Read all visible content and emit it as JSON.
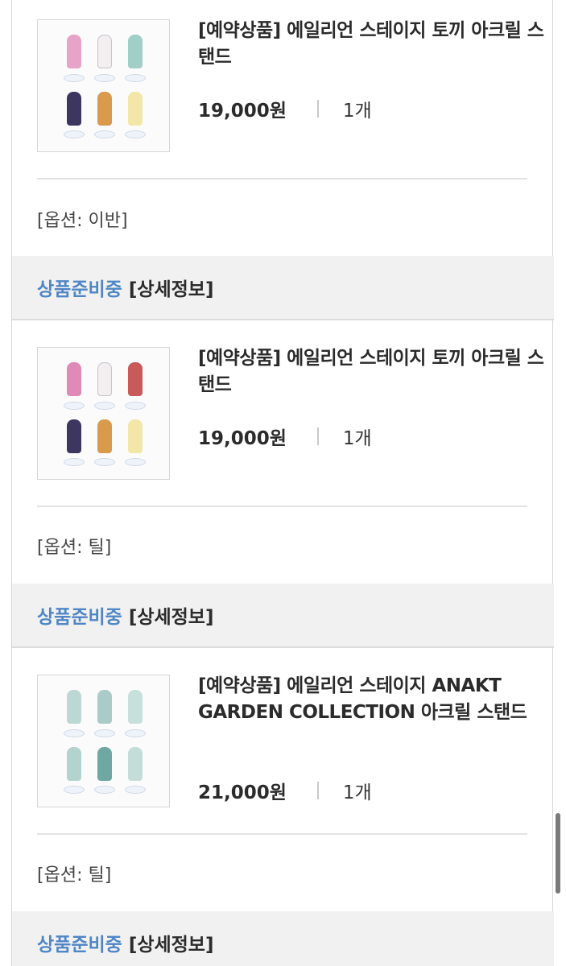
{
  "items": [
    {
      "title": "[예약상품] 에일리언 스테이지 토끼 아크릴 스탠드",
      "price": "19,000원",
      "quantity": "1개",
      "option": "[옵션: 이반]",
      "status": "상품준비중",
      "detail_link": "[상세정보]"
    },
    {
      "title": "[예약상품] 에일리언 스테이지 토끼 아크릴 스탠드",
      "price": "19,000원",
      "quantity": "1개",
      "option": "[옵션: 틸]",
      "status": "상품준비중",
      "detail_link": "[상세정보]"
    },
    {
      "title": "[예약상품] 에일리언 스테이지 ANAKT GARDEN COLLECTION 아크릴 스탠드",
      "price": "21,000원",
      "quantity": "1개",
      "option": "[옵션: 틸]",
      "status": "상품준비중",
      "detail_link": "[상세정보]"
    }
  ],
  "colors": {
    "status": "#4f86c6",
    "status_bar_bg": "#f1f1f1",
    "divider": "#e3e3e3"
  }
}
